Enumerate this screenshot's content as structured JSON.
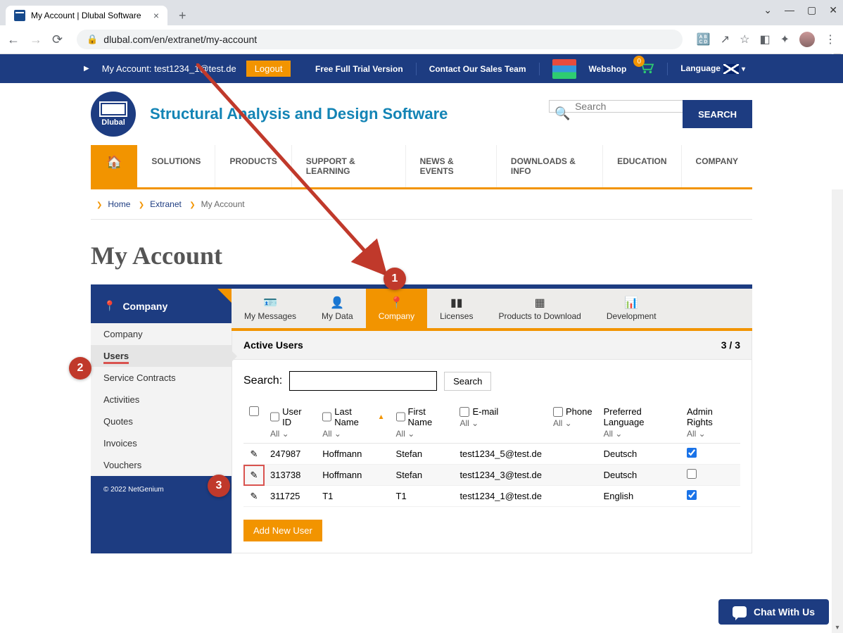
{
  "browser": {
    "tab_title": "My Account | Dlubal Software",
    "url": "dlubal.com/en/extranet/my-account"
  },
  "topstrip": {
    "account_prefix": "My Account: ",
    "account_email": "test1234_1@test.de",
    "logout": "Logout",
    "trial": "Free Full Trial Version",
    "contact": "Contact Our Sales Team",
    "webshop": "Webshop",
    "cart_count": "0",
    "language": "Language"
  },
  "header": {
    "logo_text": "Dlubal",
    "tagline": "Structural Analysis and Design Software",
    "search_placeholder": "Search",
    "search_button": "SEARCH"
  },
  "nav": [
    "SOLUTIONS",
    "PRODUCTS",
    "SUPPORT & LEARNING",
    "NEWS & EVENTS",
    "DOWNLOADS & INFO",
    "EDUCATION",
    "COMPANY"
  ],
  "breadcrumb": {
    "home": "Home",
    "extranet": "Extranet",
    "current": "My Account"
  },
  "page_title": "My Account",
  "sidebar": {
    "title": "Company",
    "items": [
      "Company",
      "Users",
      "Service Contracts",
      "Activities",
      "Quotes",
      "Invoices",
      "Vouchers"
    ],
    "active_index": 1,
    "copyright": "© 2022 NetGenium"
  },
  "tabs": {
    "items": [
      "My Messages",
      "My Data",
      "Company",
      "Licenses",
      "Products to Download",
      "Development"
    ],
    "active_index": 2
  },
  "users_panel": {
    "title": "Active Users",
    "count": "3 / 3",
    "search_label": "Search:",
    "search_button": "Search",
    "columns": [
      "User ID",
      "Last Name",
      "First Name",
      "E-mail",
      "Phone",
      "Preferred Language",
      "Admin Rights"
    ],
    "filter_label": "All",
    "rows": [
      {
        "id": "247987",
        "last": "Hoffmann",
        "first": "Stefan",
        "email": "test1234_5@test.de",
        "phone": "",
        "lang": "Deutsch",
        "admin": true
      },
      {
        "id": "313738",
        "last": "Hoffmann",
        "first": "Stefan",
        "email": "test1234_3@test.de",
        "phone": "",
        "lang": "Deutsch",
        "admin": false,
        "highlight": true
      },
      {
        "id": "311725",
        "last": "T1",
        "first": "T1",
        "email": "test1234_1@test.de",
        "phone": "",
        "lang": "English",
        "admin": true
      }
    ],
    "add_button": "Add New User"
  },
  "annotations": {
    "1": "1",
    "2": "2",
    "3": "3"
  },
  "chat": "Chat With Us"
}
